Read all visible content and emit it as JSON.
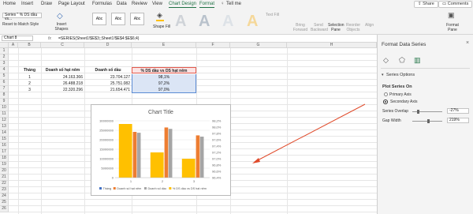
{
  "tabs": [
    "Home",
    "Insert",
    "Draw",
    "Page Layout",
    "Formulas",
    "Data",
    "Review",
    "View",
    "Chart Design",
    "Format"
  ],
  "tell_me": "Tell me",
  "share": "Share",
  "comments": "Comments",
  "ribbon": {
    "element_select": "Series \" % DS dầu vs...",
    "reset_style": "Reset to Match Style",
    "insert_shapes": "Insert Shapes",
    "shape_style_sample": "Abc",
    "shape_fill": "Shape Fill",
    "text_fill": "Text Fill",
    "bring_forward": "Bring Forward",
    "send_backward": "Send Backward",
    "selection_pane": "Selection Pane",
    "reorder_objects": "Reorder Objects",
    "align": "Align",
    "format_pane": "Format Pane",
    "wordart_sample": "A"
  },
  "formula_bar": {
    "name_box": "Chart 8",
    "fx": "fx",
    "formula": "=SERIES(Sheet1!$E$3;;Sheet1!$E$4:$E$6;4)"
  },
  "columns": [
    "A",
    "B",
    "C",
    "D",
    "E",
    "F",
    "G",
    "H"
  ],
  "rows": [
    "1",
    "2",
    "3",
    "4",
    "5",
    "6",
    "7",
    "8",
    "9",
    "10",
    "11",
    "12",
    "13",
    "14",
    "15",
    "16",
    "17",
    "18",
    "19",
    "20",
    "21",
    "22",
    "23",
    "24",
    "25",
    "26"
  ],
  "table": {
    "headers": [
      "Tháng",
      "Doanh số hạt nêm",
      "Doanh số dầu",
      "% DS dầu vs DS hạt nêm"
    ],
    "rows": [
      [
        "1",
        "24.163.366",
        "23.704.127",
        "98,1%"
      ],
      [
        "2",
        "26.488.218",
        "25.751.082",
        "97,2%"
      ],
      [
        "3",
        "22.320.296",
        "21.654.471",
        "97,0%"
      ]
    ]
  },
  "chart_data": {
    "type": "bar",
    "title": "Chart Title",
    "categories": [
      "1",
      "2",
      "3"
    ],
    "series": [
      {
        "name": "Tháng",
        "values": [
          1,
          2,
          3
        ],
        "axis": "primary",
        "color": "#4472c4"
      },
      {
        "name": "Doanh số hạt nêm",
        "values": [
          24163366,
          26488218,
          22320296
        ],
        "axis": "primary",
        "color": "#ed7d31"
      },
      {
        "name": "Doanh số dầu",
        "values": [
          23704127,
          25751082,
          21654471
        ],
        "axis": "primary",
        "color": "#a5a5a5"
      },
      {
        "name": "% DS dầu vs DS hạt nêm",
        "values": [
          98.1,
          97.2,
          97.0
        ],
        "axis": "secondary",
        "color": "#ffc000"
      }
    ],
    "primary_axis": {
      "ylim": [
        0,
        30000000
      ],
      "ticks": [
        "30000000",
        "25000000",
        "20000000",
        "15000000",
        "10000000",
        "5000000",
        "0"
      ]
    },
    "secondary_axis": {
      "ylim": [
        96.4,
        98.2
      ],
      "ticks": [
        "98,2%",
        "98,0%",
        "97,8%",
        "97,6%",
        "97,4%",
        "97,2%",
        "97,0%",
        "96,8%",
        "96,6%",
        "96,4%"
      ]
    },
    "legend_position": "bottom"
  },
  "pane": {
    "title": "Format Data Series",
    "section": "Series Options",
    "plot_on": "Plot Series On",
    "primary_axis": "Primary Axis",
    "secondary_axis": "Secondary Axis",
    "selected_axis": "secondary",
    "overlap_label": "Series Overlap",
    "overlap_value": "-27%",
    "gap_label": "Gap Width",
    "gap_value": "219%"
  },
  "colors": {
    "accent": "#217346",
    "annotation": "#e04a2a"
  }
}
